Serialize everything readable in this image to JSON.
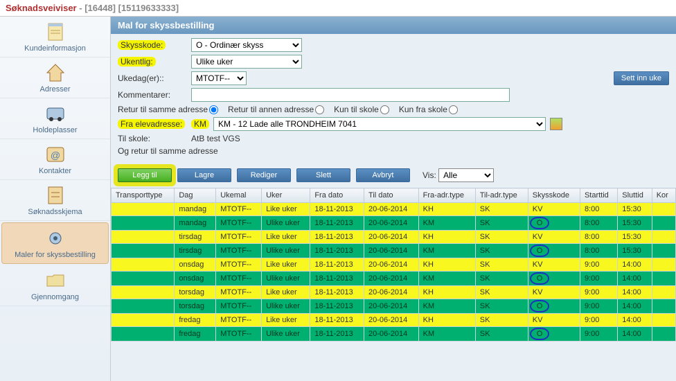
{
  "header": {
    "title": "Søknadsveiviser",
    "ids": "- [16448] [15119633333]"
  },
  "sidebar": {
    "items": [
      {
        "label": "Kundeinformasjon"
      },
      {
        "label": "Adresser"
      },
      {
        "label": "Holdeplasser"
      },
      {
        "label": "Kontakter"
      },
      {
        "label": "Søknadsskjema"
      },
      {
        "label": "Maler for skyssbestilling"
      },
      {
        "label": "Gjennomgang"
      }
    ]
  },
  "section_title": "Mal for skyssbestilling",
  "form": {
    "skysskode_label": "Skysskode:",
    "skysskode_value": "O - Ordinær skyss",
    "ukentlig_label": "Ukentlig:",
    "ukentlig_value": "Ulike uker",
    "ukedager_label": "Ukedag(er)::",
    "ukedager_value": "MTOTF--",
    "sett_inn_uke": "Sett inn uke",
    "kommentarer_label": "Kommentarer:",
    "kommentarer_value": "",
    "radio": {
      "retur_samme": "Retur til samme adresse",
      "retur_annen": "Retur til annen adresse",
      "kun_til_skole": "Kun til skole",
      "kun_fra_skole": "Kun fra skole"
    },
    "fra_elev_label": "Fra elevadresse:",
    "fra_elev_prefix": "KM",
    "fra_elev_value": "KM - 12 Lade alle TRONDHEIM 7041",
    "til_skole_label": "Til skole:",
    "til_skole_value": "AtB test VGS",
    "og_retur": "Og retur til samme adresse"
  },
  "buttons": {
    "legg_til": "Legg til",
    "lagre": "Lagre",
    "rediger": "Rediger",
    "slett": "Slett",
    "avbryt": "Avbryt",
    "vis_label": "Vis:",
    "vis_value": "Alle"
  },
  "grid": {
    "headers": [
      "Transporttype",
      "Dag",
      "Ukemal",
      "Uker",
      "Fra dato",
      "Til dato",
      "Fra-adr.type",
      "Til-adr.type",
      "Skysskode",
      "Starttid",
      "Sluttid",
      "Kor"
    ],
    "rows": [
      {
        "color": "yellow",
        "cells": [
          "",
          "mandag",
          "MTOTF--",
          "Like uker",
          "18-11-2013",
          "20-06-2014",
          "KH",
          "SK",
          "KV",
          "8:00",
          "15:30",
          ""
        ]
      },
      {
        "color": "green",
        "cells": [
          "",
          "mandag",
          "MTOTF--",
          "Ulike uker",
          "18-11-2013",
          "20-06-2014",
          "KM",
          "SK",
          "O",
          "8:00",
          "15:30",
          ""
        ],
        "circleCol": 8
      },
      {
        "color": "yellow",
        "cells": [
          "",
          "tirsdag",
          "MTOTF--",
          "Like uker",
          "18-11-2013",
          "20-06-2014",
          "KH",
          "SK",
          "KV",
          "8:00",
          "15:30",
          ""
        ]
      },
      {
        "color": "green",
        "cells": [
          "",
          "tirsdag",
          "MTOTF--",
          "Ulike uker",
          "18-11-2013",
          "20-06-2014",
          "KM",
          "SK",
          "O",
          "8:00",
          "15:30",
          ""
        ],
        "circleCol": 8
      },
      {
        "color": "yellow",
        "cells": [
          "",
          "onsdag",
          "MTOTF--",
          "Like uker",
          "18-11-2013",
          "20-06-2014",
          "KH",
          "SK",
          "KV",
          "9:00",
          "14:00",
          ""
        ]
      },
      {
        "color": "green",
        "cells": [
          "",
          "onsdag",
          "MTOTF--",
          "Ulike uker",
          "18-11-2013",
          "20-06-2014",
          "KM",
          "SK",
          "O",
          "9:00",
          "14:00",
          ""
        ],
        "circleCol": 8
      },
      {
        "color": "yellow",
        "cells": [
          "",
          "torsdag",
          "MTOTF--",
          "Like uker",
          "18-11-2013",
          "20-06-2014",
          "KH",
          "SK",
          "KV",
          "9:00",
          "14:00",
          ""
        ]
      },
      {
        "color": "green",
        "cells": [
          "",
          "torsdag",
          "MTOTF--",
          "Ulike uker",
          "18-11-2013",
          "20-06-2014",
          "KM",
          "SK",
          "O",
          "9:00",
          "14:00",
          ""
        ],
        "circleCol": 8
      },
      {
        "color": "yellow",
        "cells": [
          "",
          "fredag",
          "MTOTF--",
          "Like uker",
          "18-11-2013",
          "20-06-2014",
          "KH",
          "SK",
          "KV",
          "9:00",
          "14:00",
          ""
        ]
      },
      {
        "color": "green",
        "cells": [
          "",
          "fredag",
          "MTOTF--",
          "Ulike uker",
          "18-11-2013",
          "20-06-2014",
          "KM",
          "SK",
          "O",
          "9:00",
          "14:00",
          ""
        ],
        "circleCol": 8
      }
    ]
  }
}
